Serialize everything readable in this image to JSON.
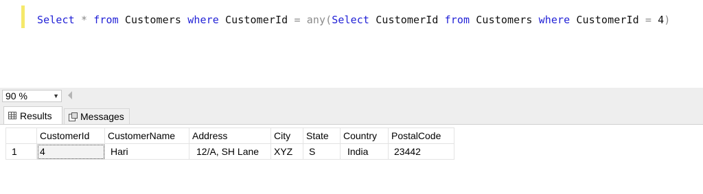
{
  "editor": {
    "tokens": [
      {
        "text": "Select",
        "kind": "kw"
      },
      {
        "text": " ",
        "kind": "id"
      },
      {
        "text": "*",
        "kind": "op"
      },
      {
        "text": " ",
        "kind": "id"
      },
      {
        "text": "from",
        "kind": "kw"
      },
      {
        "text": " Customers ",
        "kind": "id"
      },
      {
        "text": "where",
        "kind": "kw"
      },
      {
        "text": " CustomerId ",
        "kind": "id"
      },
      {
        "text": "=",
        "kind": "op"
      },
      {
        "text": " ",
        "kind": "id"
      },
      {
        "text": "any",
        "kind": "op"
      },
      {
        "text": "(",
        "kind": "op"
      },
      {
        "text": "Select",
        "kind": "kw"
      },
      {
        "text": " CustomerId ",
        "kind": "id"
      },
      {
        "text": "from",
        "kind": "kw"
      },
      {
        "text": " Customers ",
        "kind": "id"
      },
      {
        "text": "where",
        "kind": "kw"
      },
      {
        "text": " CustomerId ",
        "kind": "id"
      },
      {
        "text": "=",
        "kind": "op"
      },
      {
        "text": " 4",
        "kind": "id"
      },
      {
        "text": ")",
        "kind": "op"
      }
    ]
  },
  "zoom": {
    "value": "90 %"
  },
  "tabs": {
    "results_label": "Results",
    "messages_label": "Messages"
  },
  "grid": {
    "columns": [
      "CustomerId",
      "CustomerName",
      "Address",
      "City",
      "State",
      "Country",
      "PostalCode"
    ],
    "rows": [
      {
        "rownum": "1",
        "cells": [
          "4",
          "Hari",
          "12/A, SH Lane",
          "XYZ",
          "S",
          "India",
          "23442"
        ]
      }
    ]
  },
  "colors": {
    "keyword": "#1f1fd6",
    "operator": "#8a8a8a",
    "change_marker": "#f5e96b"
  },
  "icons": {
    "results_tab": "grid-icon",
    "messages_tab": "messages-icon",
    "zoom_dropdown": "chevron-down-icon",
    "scroll_left": "scroll-left-arrow-icon"
  }
}
